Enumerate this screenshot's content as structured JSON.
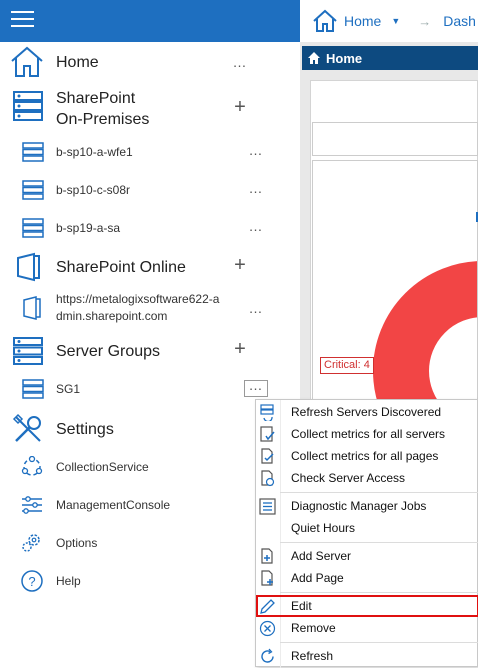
{
  "topbar": {
    "breadcrumb_home": "Home",
    "breadcrumb_next": "Dash"
  },
  "right_panel": {
    "home_bar_label": "Home",
    "critical_label": "Critical: 4"
  },
  "sidebar": {
    "home": "Home",
    "sharepoint_onprem_line1": "SharePoint",
    "sharepoint_onprem_line2": "On-Premises",
    "servers": [
      "b-sp10-a-wfe1",
      "b-sp10-c-s08r",
      "b-sp19-a-sa"
    ],
    "sharepoint_online": "SharePoint Online",
    "online_url_line1": "https://metalogixsoftware622-a",
    "online_url_line2": "dmin.sharepoint.com",
    "server_groups": "Server Groups",
    "group_sg1": "SG1",
    "settings": "Settings",
    "settings_items": [
      "CollectionService",
      "ManagementConsole",
      "Options",
      "Help"
    ]
  },
  "context_menu": {
    "items": [
      "Refresh Servers Discovered",
      "Collect metrics for all servers",
      "Collect metrics for all pages",
      "Check Server Access",
      "Diagnostic Manager Jobs",
      "Quiet Hours",
      "Add Server",
      "Add Page",
      "Edit",
      "Remove",
      "Refresh"
    ],
    "highlighted": "Edit"
  },
  "colors": {
    "brand_blue": "#1e6fc0",
    "home_bar": "#0d4a80",
    "donut_red": "#f24545",
    "highlight_red": "#e01010"
  }
}
